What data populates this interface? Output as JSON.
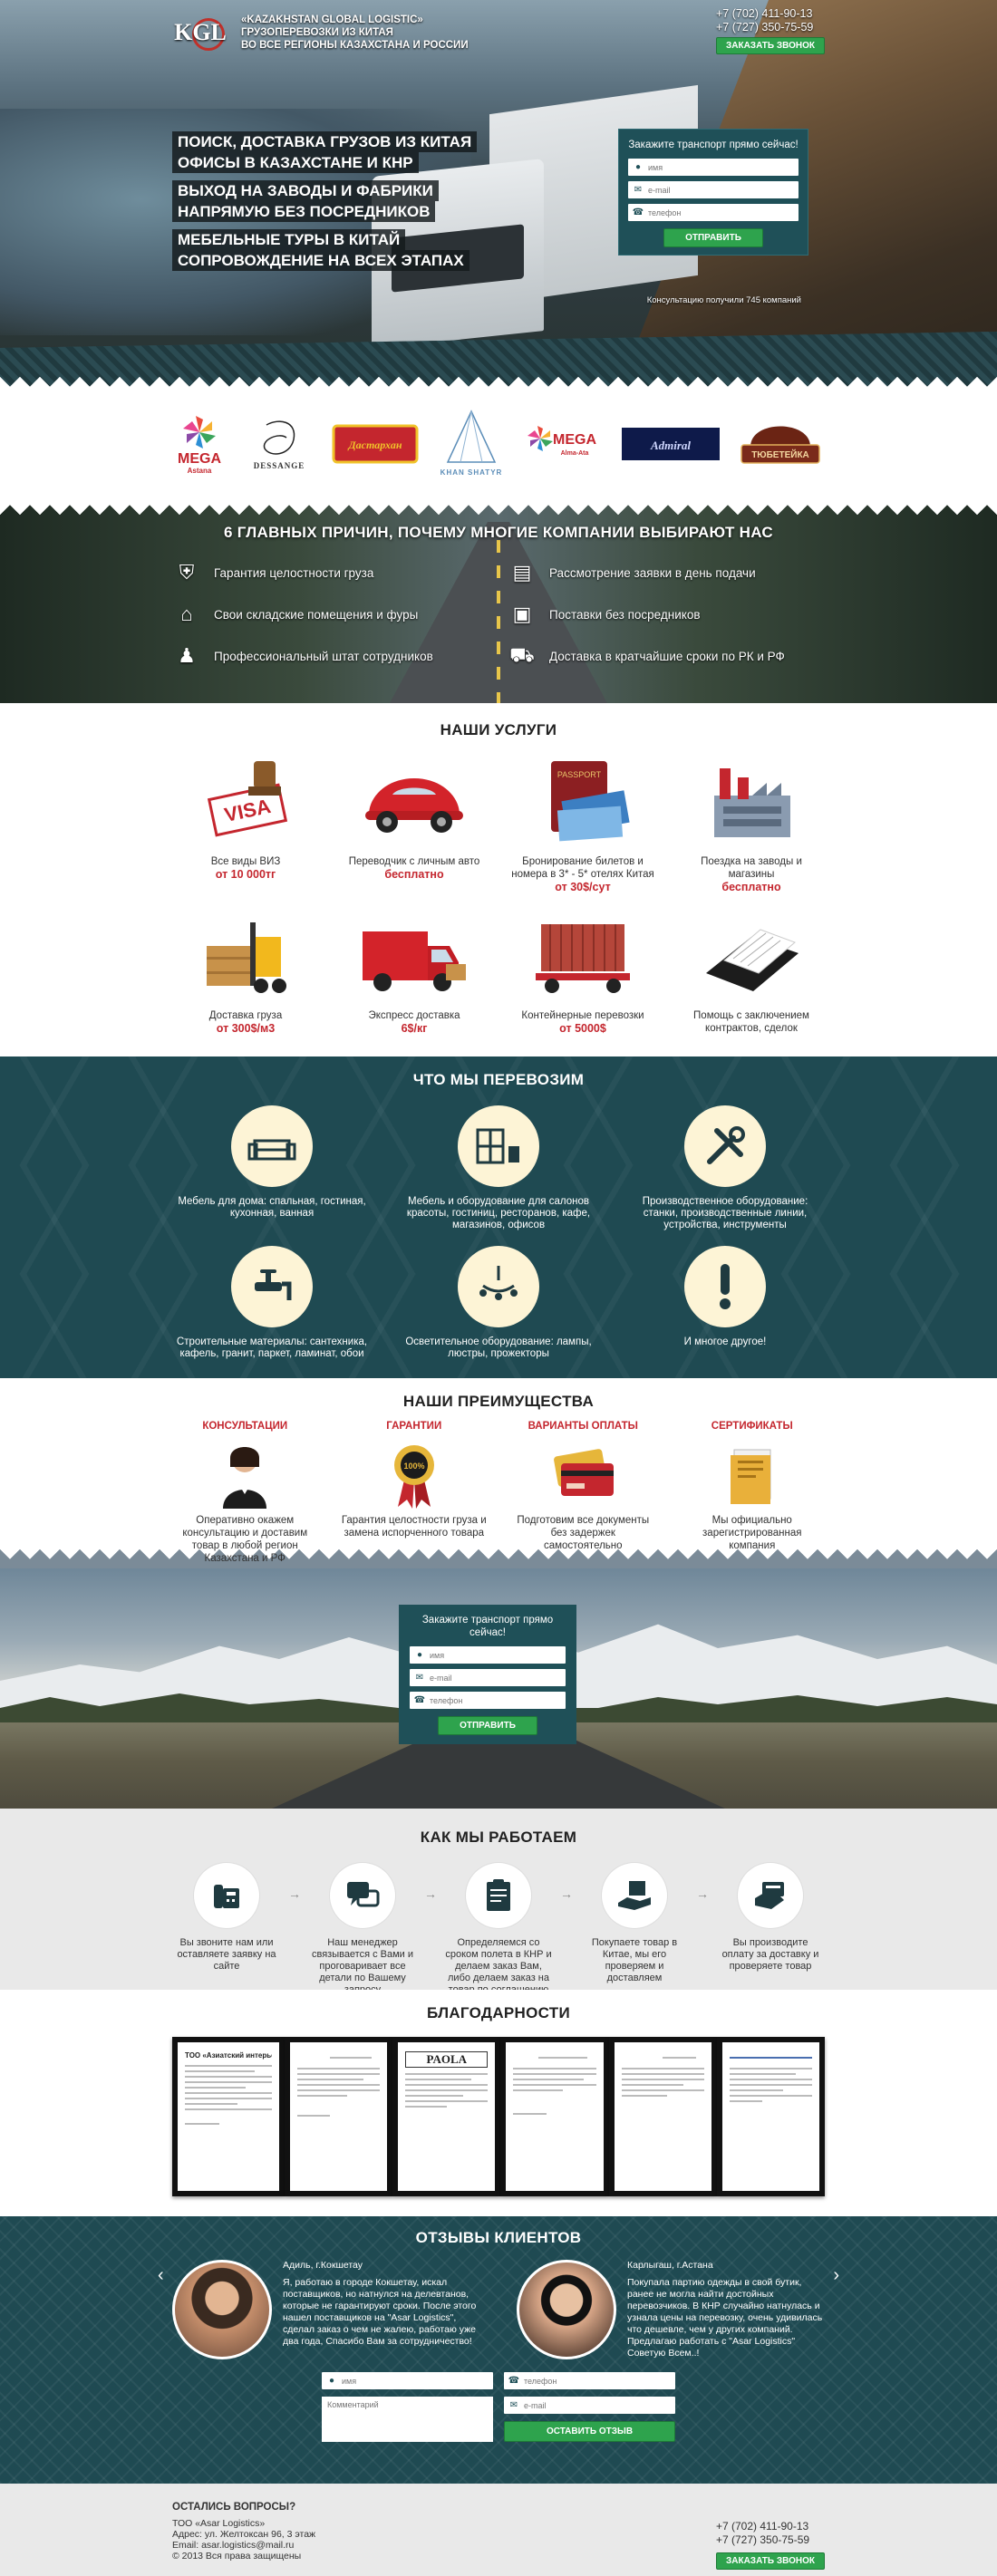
{
  "header": {
    "logo_text": "KGL",
    "company_line1": "«KAZAKHSTAN GLOBAL LOGISTIC»",
    "company_line2": "ГРУЗОПЕРЕВОЗКИ ИЗ КИТАЯ",
    "company_line3": "ВО ВСЕ РЕГИОНЫ КАЗАХСТАНА И РОССИИ",
    "phone1": "+7 (702) 411-90-13",
    "phone2": "+7 (727) 350-75-59",
    "callback_label": "ЗАКАЗАТЬ ЗВОНОК"
  },
  "hero": {
    "claims": [
      "ПОИСК, ДОСТАВКА ГРУЗОВ ИЗ КИТАЯ",
      "ОФИСЫ В КАЗАХСТАНЕ И КНР",
      "ВЫХОД НА ЗАВОДЫ И ФАБРИКИ",
      "НАПРЯМУЮ БЕЗ ПОСРЕДНИКОВ",
      "МЕБЕЛЬНЫЕ ТУРЫ В КИТАЙ",
      "СОПРОВОЖДЕНИЕ НА ВСЕХ ЭТАПАХ"
    ],
    "form": {
      "title": "Закажите транспорт прямо сейчас!",
      "name_placeholder": "имя",
      "email_placeholder": "e-mail",
      "phone_placeholder": "телефон",
      "submit_label": "ОТПРАВИТЬ"
    },
    "note": "Консультацию получили 745 компаний"
  },
  "partners": {
    "logos": [
      {
        "name": "MEGA",
        "sub": "Astana",
        "color": "#c4262e"
      },
      {
        "name": "DESSANGE",
        "sub": "",
        "color": "#333333"
      },
      {
        "name": "Дастархан",
        "sub": "",
        "color": "#f0c32a"
      },
      {
        "name": "KHAN SHATYR",
        "sub": "",
        "color": "#5b8db8"
      },
      {
        "name": "MEGA",
        "sub": "Alma-Ata",
        "color": "#c4262e"
      },
      {
        "name": "Admiral",
        "sub": "",
        "color": "#1a2b6b"
      },
      {
        "name": "ТЮБЕТЕЙКА",
        "sub": "",
        "color": "#7a2a1a"
      }
    ]
  },
  "reasons": {
    "title": "6 ГЛАВНЫХ ПРИЧИН, ПОЧЕМУ МНОГИЕ КОМПАНИИ ВЫБИРАЮТ НАС",
    "items": [
      {
        "icon": "shield-check-icon",
        "text": "Гарантия целостности груза"
      },
      {
        "icon": "document-list-icon",
        "text": "Рассмотрение заявки в день подачи"
      },
      {
        "icon": "warehouse-icon",
        "text": "Свои складские помещения и фуры"
      },
      {
        "icon": "box-icon",
        "text": "Поставки без посредников"
      },
      {
        "icon": "worker-icon",
        "text": "Профессиональный штат сотрудников"
      },
      {
        "icon": "delivery-truck-icon",
        "text": "Доставка в кратчайшие сроки по РК и РФ"
      }
    ]
  },
  "services": {
    "title": "НАШИ УСЛУГИ",
    "items": [
      {
        "icon": "visa-stamp-icon",
        "line1": "Все виды ВИЗ",
        "prefix": "от ",
        "highlight": "10 000тг"
      },
      {
        "icon": "red-car-icon",
        "line1": "Переводчик с личным авто",
        "prefix": "",
        "highlight": "бесплатно"
      },
      {
        "icon": "passport-tickets-icon",
        "line1": "Бронирование билетов и номера в 3* - 5* отелях Китая",
        "prefix": "",
        "highlight": "от 30$/сут"
      },
      {
        "icon": "factory-icon",
        "line1": "Поездка на заводы и магазины",
        "prefix": "",
        "highlight": "бесплатно"
      },
      {
        "icon": "forklift-icon",
        "line1": "Доставка груза",
        "prefix": "от ",
        "highlight": "300$/м3"
      },
      {
        "icon": "van-icon",
        "line1": "Экспресс доставка",
        "prefix": "",
        "highlight": "6$/кг"
      },
      {
        "icon": "container-icon",
        "line1": "Контейнерные перевозки",
        "prefix": "от ",
        "highlight": "5000$"
      },
      {
        "icon": "folder-contract-icon",
        "line1": "Помощь с заключением контрактов, сделок",
        "prefix": "",
        "highlight": ""
      }
    ]
  },
  "transport": {
    "title": "ЧТО МЫ ПЕРЕВОЗИМ",
    "items": [
      {
        "icon": "sofa-icon",
        "text": "Мебель для дома: спальная, гостиная, кухонная, ванная"
      },
      {
        "icon": "furniture-icon",
        "text": "Мебель и оборудование для салонов красоты, гостиниц, ресторанов, кафе, магазинов, офисов"
      },
      {
        "icon": "tools-icon",
        "text": "Производственное оборудование: станки, производственные линии, устройства, инструменты"
      },
      {
        "icon": "faucet-icon",
        "text": "Строительные материалы: сантехника, кафель, гранит, паркет, ламинат, обои"
      },
      {
        "icon": "chandelier-icon",
        "text": "Осветительное оборудование: лампы, люстры, прожекторы"
      },
      {
        "icon": "exclamation-icon",
        "text": "И многое другое!"
      }
    ]
  },
  "advantages": {
    "title": "НАШИ ПРЕИМУЩЕСТВА",
    "items": [
      {
        "icon": "consultant-icon",
        "heading": "КОНСУЛЬТАЦИИ",
        "text": "Оперативно окажем консультацию и доставим товар в любой регион Казахстана и РФ"
      },
      {
        "icon": "guarantee-seal-icon",
        "heading": "ГАРАНТИИ",
        "text": "Гарантия целостности груза и замена испорченного товара"
      },
      {
        "icon": "credit-cards-icon",
        "heading": "ВАРИАНТЫ ОПЛАТЫ",
        "text": "Подготовим все документы без задержек самостоятельно"
      },
      {
        "icon": "certificate-folder-icon",
        "heading": "СЕРТИФИКАТЫ",
        "text": "Мы официально зарегистрированная компания"
      }
    ]
  },
  "midform": {
    "title": "Закажите транспорт прямо сейчас!",
    "name_placeholder": "имя",
    "email_placeholder": "e-mail",
    "phone_placeholder": "телефон",
    "submit_label": "ОТПРАВИТЬ"
  },
  "how": {
    "title": "КАК МЫ РАБОТАЕМ",
    "steps": [
      {
        "icon": "phone-fax-icon",
        "text": "Вы звоните нам или оставляете заявку на сайте"
      },
      {
        "icon": "chat-bubbles-icon",
        "text": "Наш менеджер связывается с Вами и проговаривает все детали по Вашему запросу"
      },
      {
        "icon": "clipboard-icon",
        "text": "Определяемся со сроком полета в КНР и делаем заказ Вам, либо делаем заказ на товар по соглашению сторон"
      },
      {
        "icon": "hand-box-icon",
        "text": "Покупаете товар в Китае, мы его проверяем и доставляем"
      },
      {
        "icon": "card-payment-icon",
        "text": "Вы производите оплату за доставку и проверяете товар"
      }
    ]
  },
  "thanks": {
    "title": "БЛАГОДАРНОСТИ",
    "docs": [
      {
        "header": "ТОО «Азиатский интерьер»"
      },
      {
        "header": ""
      },
      {
        "header": "PAOLA"
      },
      {
        "header": ""
      },
      {
        "header": ""
      },
      {
        "header": ""
      }
    ]
  },
  "reviews": {
    "title": "ОТЗЫВЫ КЛИЕНТОВ",
    "items": [
      {
        "author": "Адиль, г.Кокшетау",
        "text": "Я, работаю в городе Кокшетау, искал поставщиков, но натнулся на делевтанов, которые не гарантируют сроки. После этого нашел поставщиков на \"Asar Logistics\", сделал заказ о чем не жалею, работаю уже два года, Спасибо Вам за сотрудничество!"
      },
      {
        "author": "Карлыгаш, г.Астана",
        "text": "Покупала партию одежды в свой бутик, ранее не могла найти достойных перевозчиков. В КНР случайно натнулась и узнала цены на перевозку, очень удивилась что дешевле, чем у других компаний. Предлагаю работать с \"Asar Logistics\" Советую Всем..!"
      }
    ],
    "form": {
      "name_placeholder": "имя",
      "phone_placeholder": "телефон",
      "comment_placeholder": "Комментарий",
      "email_placeholder": "e-mail",
      "submit_label": "ОСТАВИТЬ ОТЗЫВ"
    }
  },
  "footer": {
    "question": "ОСТАЛИСЬ ВОПРОСЫ?",
    "company": "ТОО «Asar Logistics»",
    "address": "Адрес: ул. Желтоксан 96, 3 этаж",
    "email": "Email: asar.logistics@mail.ru",
    "copyright": "© 2013 Вся права защищены",
    "phone1": "+7 (702) 411-90-13",
    "phone2": "+7 (727) 350-75-59",
    "callback_label": "ЗАКАЗАТЬ ЗВОНОК"
  },
  "colors": {
    "accent_green": "#2ea34d",
    "teal": "#1f4a52",
    "red": "#c4262e"
  }
}
